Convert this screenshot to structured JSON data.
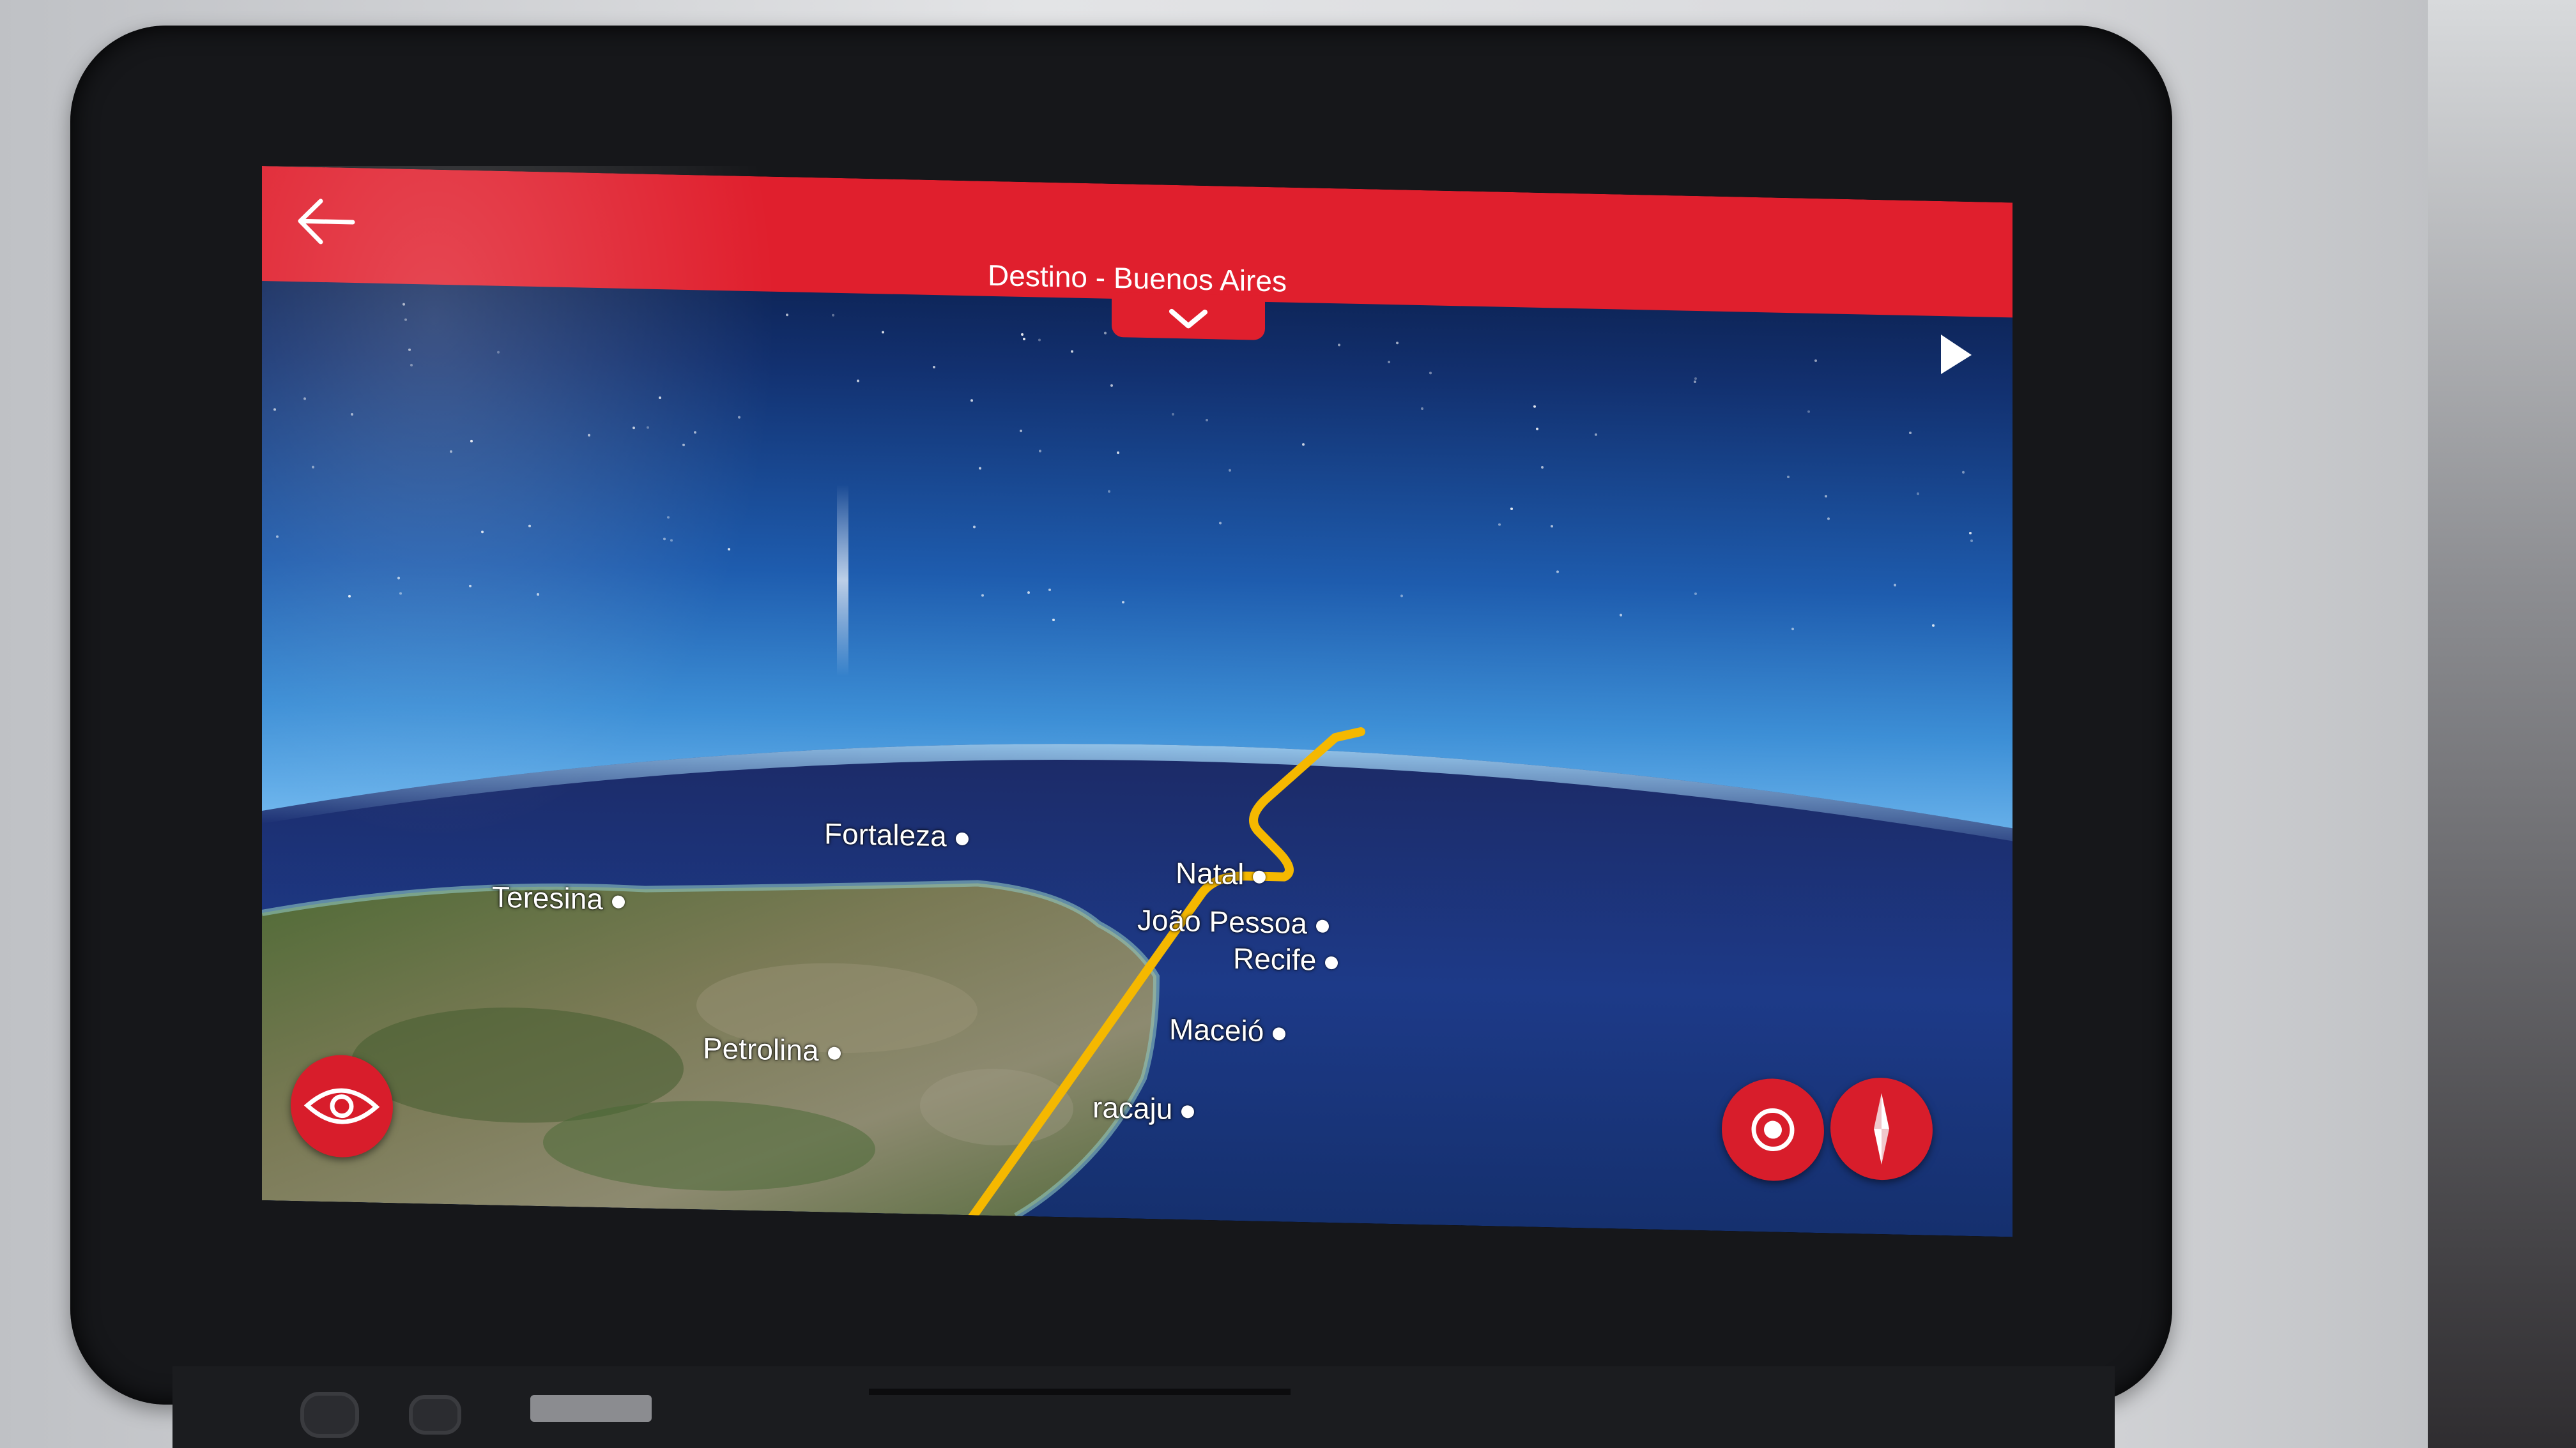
{
  "header": {
    "title": "Destino - Buenos Aires",
    "back_icon": "back-arrow-icon",
    "collapse_icon": "chevron-down-icon",
    "next_icon": "play-icon",
    "bar_color": "#e01f2d"
  },
  "map": {
    "route_color": "#f5b800",
    "cities": [
      {
        "name": "Fortaleza"
      },
      {
        "name": "Teresina"
      },
      {
        "name": "Natal"
      },
      {
        "name": "João Pessoa"
      },
      {
        "name": "Recife"
      },
      {
        "name": "Maceió"
      },
      {
        "name": "Petrolina"
      },
      {
        "name": "racaju"
      }
    ]
  },
  "controls": {
    "view_icon": "eye-icon",
    "center_icon": "target-icon",
    "compass_icon": "compass-icon",
    "button_color": "#d81d2b"
  }
}
